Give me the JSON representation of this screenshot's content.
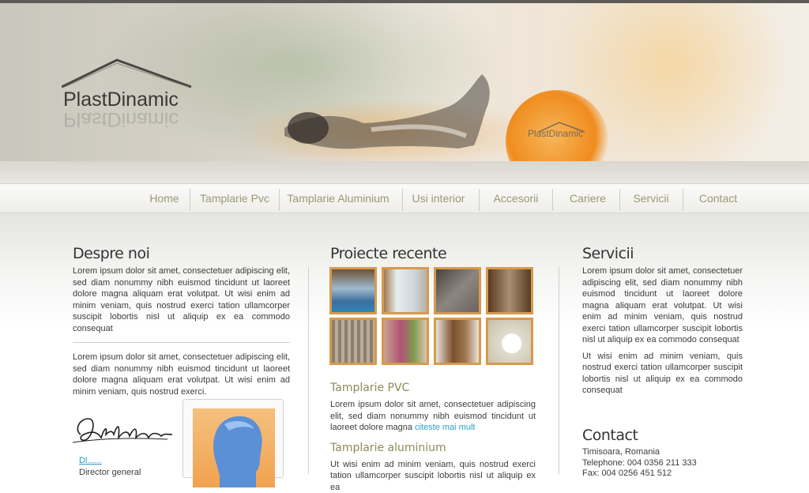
{
  "header": {
    "logo_text": "PlastDinamic",
    "logo_small_text": "PlastDinamic"
  },
  "nav": {
    "items": [
      {
        "label": "Home"
      },
      {
        "label": "Tamplarie Pvc"
      },
      {
        "label": "Tamplarie Aluminium"
      },
      {
        "label": "Usi interior"
      },
      {
        "label": "Accesorii"
      },
      {
        "label": "Cariere"
      },
      {
        "label": "Servicii"
      },
      {
        "label": "Contact"
      }
    ]
  },
  "about": {
    "title": "Despre noi",
    "para1": "Lorem ipsum dolor sit amet, consectetuer adipiscing elit, sed diam nonummy nibh euismod tincidunt ut laoreet dolore magna aliquam erat volutpat. Ut wisi enim ad minim veniam, quis nostrud exerci tation ullamcorper suscipit lobortis nisl ut aliquip ex ea commodo consequat",
    "para2": "Lorem ipsum dolor sit amet, consectetuer adipiscing elit, sed diam nonummy nibh euismod tincidunt ut laoreet dolore magna aliquam erat volutpat. Ut wisi enim ad minim veniam, quis nostrud exerci.",
    "signature_link": "Dl......",
    "signature_role": "Director general"
  },
  "projects": {
    "title": "Proiecte recente",
    "thumbs": [
      {
        "name": "project-thumb-1",
        "color": "#3d6f9e"
      },
      {
        "name": "project-thumb-2",
        "color": "#cfd6dc"
      },
      {
        "name": "project-thumb-3",
        "color": "#6b6560"
      },
      {
        "name": "project-thumb-4",
        "color": "#5b3a23"
      },
      {
        "name": "project-thumb-5",
        "color": "#8d7f6c"
      },
      {
        "name": "project-thumb-6",
        "color": "#b0527a"
      },
      {
        "name": "project-thumb-7",
        "color": "#7a4f2e"
      },
      {
        "name": "project-thumb-8",
        "color": "#e0ddcf"
      }
    ],
    "pvc_title": "Tamplarie PVC",
    "pvc_text": "Lorem ipsum dolor sit amet, consectetuer adipiscing elit, sed diam nonummy nibh euismod tincidunt ut laoreet dolore magna",
    "pvc_more": "citeste mai mult",
    "alu_title": "Tamplarie aluminium",
    "alu_text": "Ut wisi enim ad minim veniam, quis nostrud exerci tation ullamcorper suscipit lobortis nisl ut aliquip ex ea"
  },
  "services": {
    "title": "Servicii",
    "para1": "Lorem ipsum dolor sit amet, consectetuer adipiscing elit, sed diam nonummy nibh euismod tincidunt ut laoreet dolore magna aliquam erat volutpat. Ut wisi enim ad minim veniam, quis nostrud exerci tation ullamcorper suscipit lobortis nisl ut aliquip ex ea commodo consequat",
    "para2": "Ut wisi enim ad minim veniam, quis nostrud exerci tation ullamcorper suscipit lobortis nisl ut aliquip ex ea commodo consequat"
  },
  "contact": {
    "title": "Contact",
    "city": "Timisoara, Romania",
    "phone": "Telephone: 004 0356 211 333",
    "fax": "Fax: 004 0256 451 512"
  },
  "colors": {
    "accent": "#d79a4d",
    "link": "#2b9fc8",
    "nav_text": "#9a9a72"
  }
}
